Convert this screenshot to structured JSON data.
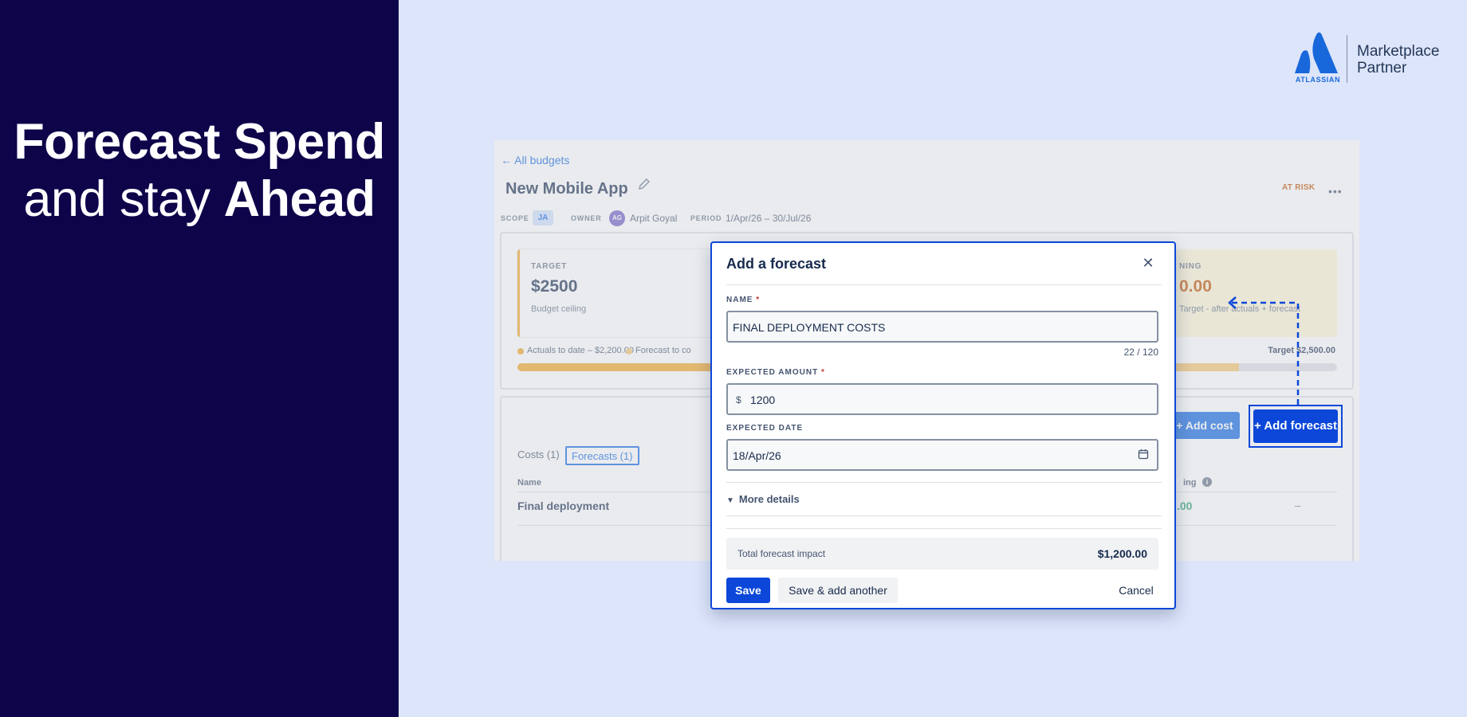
{
  "hero": {
    "line1": "Forecast Spend",
    "line2_pre": "and stay ",
    "line2_bold": "Ahead"
  },
  "badge": {
    "brand": "ATLASSIAN",
    "text_line1": "Marketplace",
    "text_line2": "Partner"
  },
  "app": {
    "back_link": "← All budgets",
    "title": "New Mobile App",
    "status": "AT RISK",
    "more": "•••",
    "meta": {
      "scope_label": "SCOPE",
      "scope_value": "JA",
      "owner_label": "OWNER",
      "owner_initials": "AG",
      "owner_name": "Arpit Goyal",
      "period_label": "PERIOD",
      "period_value": "1/Apr/26 – 30/Jul/26"
    },
    "target": {
      "label": "TARGET",
      "value": "$2500",
      "sub": "Budget ceiling"
    },
    "remaining": {
      "label": "NING",
      "value": "0.00",
      "sub": "Target - after actuals + forecast"
    },
    "legend": {
      "actuals": "Actuals to date – $2,200.00",
      "forecast": "Forecast to co",
      "target": "Target $2,500.00"
    },
    "progress": {
      "actual_fraction": 0.25,
      "forecast_end_fraction": 0.88
    },
    "colors": {
      "accent": "#0c66e4",
      "warning": "#f5a623"
    },
    "add_cost": "+ Add cost",
    "add_forecast": "+ Add forecast",
    "tabs": [
      {
        "label": "Costs (1)"
      },
      {
        "label": "Forecasts (1)"
      }
    ],
    "table": {
      "col_name": "Name",
      "col_remaining": "ing",
      "row_name": "Final deployment",
      "row_remaining": ".00",
      "row_dash": "–"
    }
  },
  "modal": {
    "title": "Add a forecast",
    "name_label": "NAME",
    "name_value": "FINAL DEPLOYMENT COSTS",
    "char_count": "22 / 120",
    "amount_label": "EXPECTED AMOUNT",
    "currency": "$",
    "amount_value": "1200",
    "date_label": "EXPECTED DATE",
    "date_value": "18/Apr/26",
    "more_details": "More details",
    "impact_label": "Total forecast impact",
    "impact_value": "$1,200.00",
    "save": "Save",
    "save_another": "Save & add another",
    "cancel": "Cancel",
    "required_mark": "*"
  }
}
